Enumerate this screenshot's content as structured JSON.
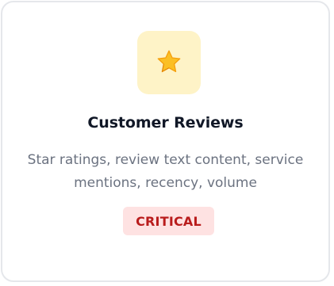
{
  "card": {
    "icon": "star-icon",
    "title": "Customer Reviews",
    "description": "Star ratings, review text content, service mentions, recency, volume",
    "badge": "CRITICAL"
  },
  "colors": {
    "icon_tile_bg": "#fef3c7",
    "star": "#fbbf24",
    "title": "#111827",
    "description": "#6b7280",
    "badge_bg": "#fee2e2",
    "badge_text": "#b91c1c",
    "card_border": "#e5e7eb"
  }
}
